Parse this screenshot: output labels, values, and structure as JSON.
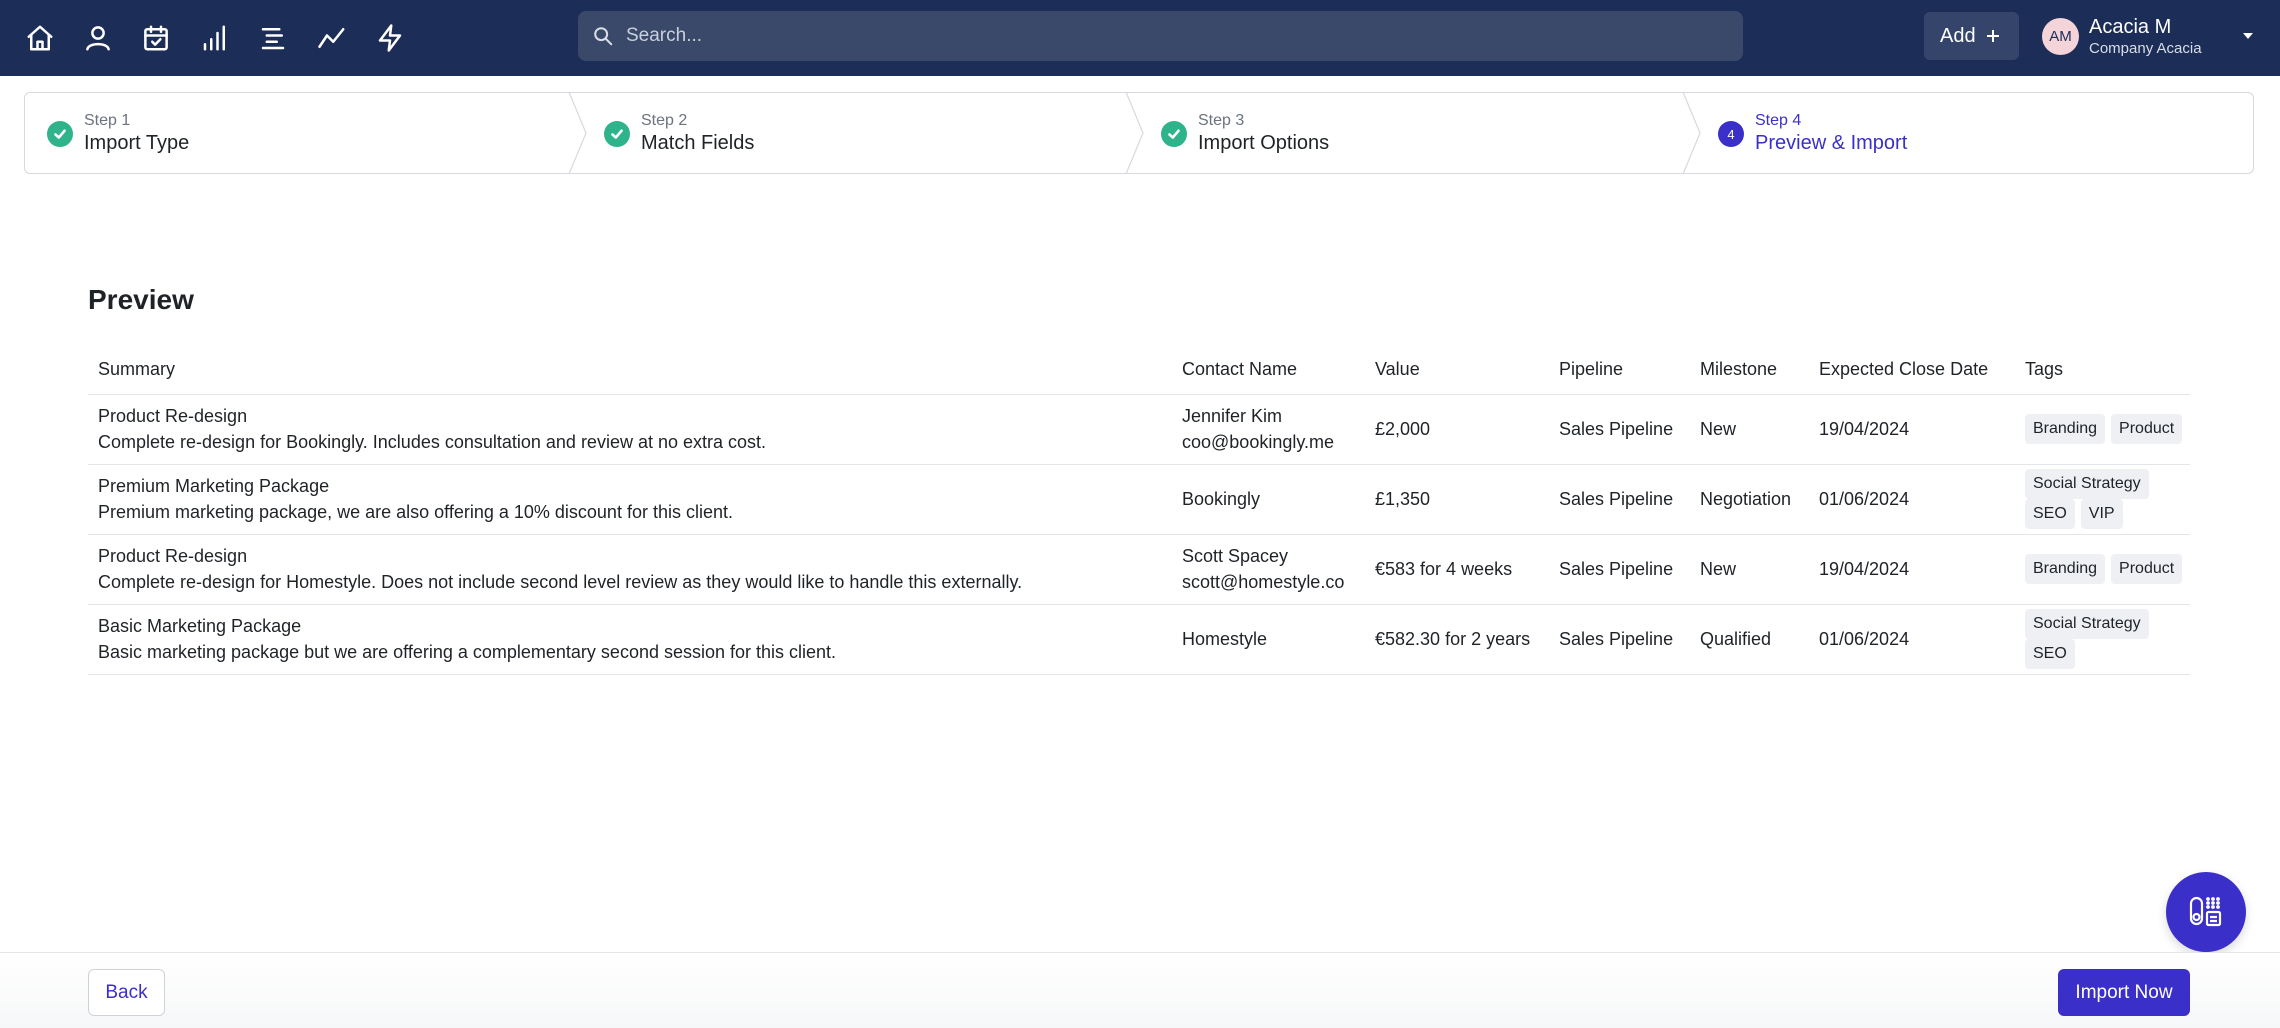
{
  "nav": {
    "icons": [
      "home-icon",
      "person-icon",
      "calendar-check-icon",
      "bar-chart-icon",
      "list-icon",
      "trend-line-icon",
      "lightning-icon"
    ]
  },
  "search": {
    "placeholder": "Search..."
  },
  "header": {
    "add_label": "Add",
    "user": {
      "initials": "AM",
      "name": "Acacia M",
      "company": "Company Acacia"
    }
  },
  "stepper": {
    "steps": [
      {
        "num": "Step 1",
        "title": "Import Type",
        "state": "done"
      },
      {
        "num": "Step 2",
        "title": "Match Fields",
        "state": "done"
      },
      {
        "num": "Step 3",
        "title": "Import Options",
        "state": "done"
      },
      {
        "num": "Step 4",
        "title": "Preview & Import",
        "state": "active",
        "badge": "4"
      }
    ]
  },
  "preview": {
    "title": "Preview",
    "columns": [
      "Summary",
      "Contact Name",
      "Value",
      "Pipeline",
      "Milestone",
      "Expected Close Date",
      "Tags"
    ],
    "rows": [
      {
        "title": "Product Re-design",
        "desc": "Complete re-design for Bookingly. Includes consultation and review at no extra cost.",
        "contact": "Jennifer Kim",
        "email": "coo@bookingly.me",
        "value": "£2,000",
        "pipeline": "Sales Pipeline",
        "milestone": "New",
        "close_date": "19/04/2024",
        "tags": [
          "Branding",
          "Product"
        ]
      },
      {
        "title": "Premium Marketing Package",
        "desc": "Premium marketing package, we are also offering a 10% discount for this client.",
        "contact": "Bookingly",
        "email": "",
        "value": "£1,350",
        "pipeline": "Sales Pipeline",
        "milestone": "Negotiation",
        "close_date": "01/06/2024",
        "tags": [
          "Social Strategy",
          "SEO",
          "VIP"
        ]
      },
      {
        "title": "Product Re-design",
        "desc": "Complete re-design for Homestyle. Does not include second level review as they would like to handle this externally.",
        "contact": "Scott Spacey",
        "email": "scott@homestyle.co",
        "value": "€583 for 4 weeks",
        "pipeline": "Sales Pipeline",
        "milestone": "New",
        "close_date": "19/04/2024",
        "tags": [
          "Branding",
          "Product"
        ]
      },
      {
        "title": "Basic Marketing Package",
        "desc": "Basic marketing package but we are offering a complementary second session for this client.",
        "contact": "Homestyle",
        "email": "",
        "value": "€582.30 for 2 years",
        "pipeline": "Sales Pipeline",
        "milestone": "Qualified",
        "close_date": "01/06/2024",
        "tags": [
          "Social Strategy",
          "SEO"
        ]
      }
    ]
  },
  "footer": {
    "back_label": "Back",
    "import_label": "Import Now"
  },
  "colors": {
    "nav_bg": "#1c2d57",
    "accent": "#3b2fc9",
    "done": "#2fb38a"
  }
}
